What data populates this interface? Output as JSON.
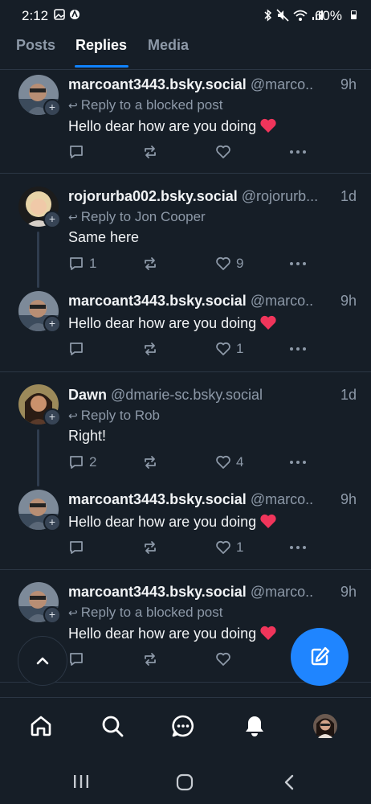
{
  "status_bar": {
    "time": "2:12",
    "battery": "60%"
  },
  "tabs": [
    {
      "label": "Posts"
    },
    {
      "label": "Replies"
    },
    {
      "label": "Media"
    }
  ],
  "posts": [
    {
      "name": "marcoant3443.bsky.social",
      "handle": "@marco..",
      "time": "9h",
      "reply_to": "Reply to a blocked post",
      "text": "Hello dear how are you doing",
      "reply_count": "",
      "repost_count": "",
      "like_count": ""
    },
    {
      "name": "rojorurba002.bsky.social",
      "handle": "@rojorurb...",
      "time": "1d",
      "reply_to": "Reply to Jon Cooper",
      "text": "Same here",
      "reply_count": "1",
      "repost_count": "",
      "like_count": "9"
    },
    {
      "name": "marcoant3443.bsky.social",
      "handle": "@marco..",
      "time": "9h",
      "reply_to": "",
      "text": "Hello dear how are you doing",
      "reply_count": "",
      "repost_count": "",
      "like_count": "1"
    },
    {
      "name": "Dawn",
      "handle": "@dmarie-sc.bsky.social",
      "time": "1d",
      "reply_to": "Reply to Rob",
      "text": "Right!",
      "reply_count": "2",
      "repost_count": "",
      "like_count": "4"
    },
    {
      "name": "marcoant3443.bsky.social",
      "handle": "@marco..",
      "time": "9h",
      "reply_to": "",
      "text": "Hello dear how are you doing",
      "reply_count": "",
      "repost_count": "",
      "like_count": "1"
    },
    {
      "name": "marcoant3443.bsky.social",
      "handle": "@marco..",
      "time": "9h",
      "reply_to": "Reply to a blocked post",
      "text": "Hello dear how are you doing",
      "reply_count": "",
      "repost_count": "",
      "like_count": ""
    }
  ],
  "bottom_nav": [
    {
      "icon": "home-icon"
    },
    {
      "icon": "search-icon"
    },
    {
      "icon": "chat-icon"
    },
    {
      "icon": "notifications-bell-icon"
    },
    {
      "icon": "profile-avatar"
    }
  ],
  "colors": {
    "background": "#161e27",
    "accent": "#1083fe",
    "fab": "#1f85ff",
    "muted": "#8d99a8",
    "heart": "#f0355b"
  }
}
